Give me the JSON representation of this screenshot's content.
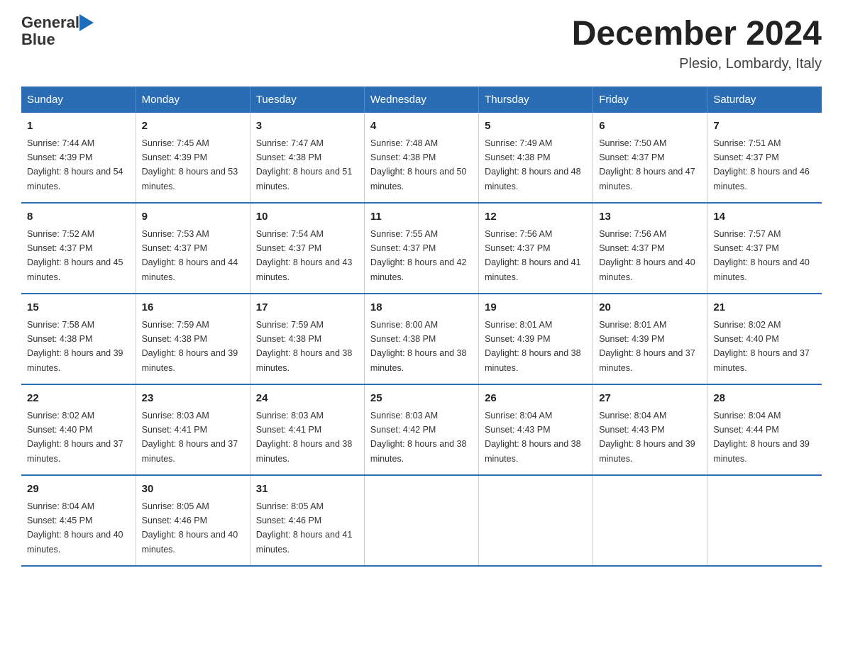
{
  "logo": {
    "line1": "General",
    "arrow": "▶",
    "line2": "Blue"
  },
  "title": "December 2024",
  "location": "Plesio, Lombardy, Italy",
  "days_of_week": [
    "Sunday",
    "Monday",
    "Tuesday",
    "Wednesday",
    "Thursday",
    "Friday",
    "Saturday"
  ],
  "weeks": [
    [
      {
        "day": "1",
        "sunrise": "7:44 AM",
        "sunset": "4:39 PM",
        "daylight": "8 hours and 54 minutes."
      },
      {
        "day": "2",
        "sunrise": "7:45 AM",
        "sunset": "4:39 PM",
        "daylight": "8 hours and 53 minutes."
      },
      {
        "day": "3",
        "sunrise": "7:47 AM",
        "sunset": "4:38 PM",
        "daylight": "8 hours and 51 minutes."
      },
      {
        "day": "4",
        "sunrise": "7:48 AM",
        "sunset": "4:38 PM",
        "daylight": "8 hours and 50 minutes."
      },
      {
        "day": "5",
        "sunrise": "7:49 AM",
        "sunset": "4:38 PM",
        "daylight": "8 hours and 48 minutes."
      },
      {
        "day": "6",
        "sunrise": "7:50 AM",
        "sunset": "4:37 PM",
        "daylight": "8 hours and 47 minutes."
      },
      {
        "day": "7",
        "sunrise": "7:51 AM",
        "sunset": "4:37 PM",
        "daylight": "8 hours and 46 minutes."
      }
    ],
    [
      {
        "day": "8",
        "sunrise": "7:52 AM",
        "sunset": "4:37 PM",
        "daylight": "8 hours and 45 minutes."
      },
      {
        "day": "9",
        "sunrise": "7:53 AM",
        "sunset": "4:37 PM",
        "daylight": "8 hours and 44 minutes."
      },
      {
        "day": "10",
        "sunrise": "7:54 AM",
        "sunset": "4:37 PM",
        "daylight": "8 hours and 43 minutes."
      },
      {
        "day": "11",
        "sunrise": "7:55 AM",
        "sunset": "4:37 PM",
        "daylight": "8 hours and 42 minutes."
      },
      {
        "day": "12",
        "sunrise": "7:56 AM",
        "sunset": "4:37 PM",
        "daylight": "8 hours and 41 minutes."
      },
      {
        "day": "13",
        "sunrise": "7:56 AM",
        "sunset": "4:37 PM",
        "daylight": "8 hours and 40 minutes."
      },
      {
        "day": "14",
        "sunrise": "7:57 AM",
        "sunset": "4:37 PM",
        "daylight": "8 hours and 40 minutes."
      }
    ],
    [
      {
        "day": "15",
        "sunrise": "7:58 AM",
        "sunset": "4:38 PM",
        "daylight": "8 hours and 39 minutes."
      },
      {
        "day": "16",
        "sunrise": "7:59 AM",
        "sunset": "4:38 PM",
        "daylight": "8 hours and 39 minutes."
      },
      {
        "day": "17",
        "sunrise": "7:59 AM",
        "sunset": "4:38 PM",
        "daylight": "8 hours and 38 minutes."
      },
      {
        "day": "18",
        "sunrise": "8:00 AM",
        "sunset": "4:38 PM",
        "daylight": "8 hours and 38 minutes."
      },
      {
        "day": "19",
        "sunrise": "8:01 AM",
        "sunset": "4:39 PM",
        "daylight": "8 hours and 38 minutes."
      },
      {
        "day": "20",
        "sunrise": "8:01 AM",
        "sunset": "4:39 PM",
        "daylight": "8 hours and 37 minutes."
      },
      {
        "day": "21",
        "sunrise": "8:02 AM",
        "sunset": "4:40 PM",
        "daylight": "8 hours and 37 minutes."
      }
    ],
    [
      {
        "day": "22",
        "sunrise": "8:02 AM",
        "sunset": "4:40 PM",
        "daylight": "8 hours and 37 minutes."
      },
      {
        "day": "23",
        "sunrise": "8:03 AM",
        "sunset": "4:41 PM",
        "daylight": "8 hours and 37 minutes."
      },
      {
        "day": "24",
        "sunrise": "8:03 AM",
        "sunset": "4:41 PM",
        "daylight": "8 hours and 38 minutes."
      },
      {
        "day": "25",
        "sunrise": "8:03 AM",
        "sunset": "4:42 PM",
        "daylight": "8 hours and 38 minutes."
      },
      {
        "day": "26",
        "sunrise": "8:04 AM",
        "sunset": "4:43 PM",
        "daylight": "8 hours and 38 minutes."
      },
      {
        "day": "27",
        "sunrise": "8:04 AM",
        "sunset": "4:43 PM",
        "daylight": "8 hours and 39 minutes."
      },
      {
        "day": "28",
        "sunrise": "8:04 AM",
        "sunset": "4:44 PM",
        "daylight": "8 hours and 39 minutes."
      }
    ],
    [
      {
        "day": "29",
        "sunrise": "8:04 AM",
        "sunset": "4:45 PM",
        "daylight": "8 hours and 40 minutes."
      },
      {
        "day": "30",
        "sunrise": "8:05 AM",
        "sunset": "4:46 PM",
        "daylight": "8 hours and 40 minutes."
      },
      {
        "day": "31",
        "sunrise": "8:05 AM",
        "sunset": "4:46 PM",
        "daylight": "8 hours and 41 minutes."
      },
      null,
      null,
      null,
      null
    ]
  ]
}
